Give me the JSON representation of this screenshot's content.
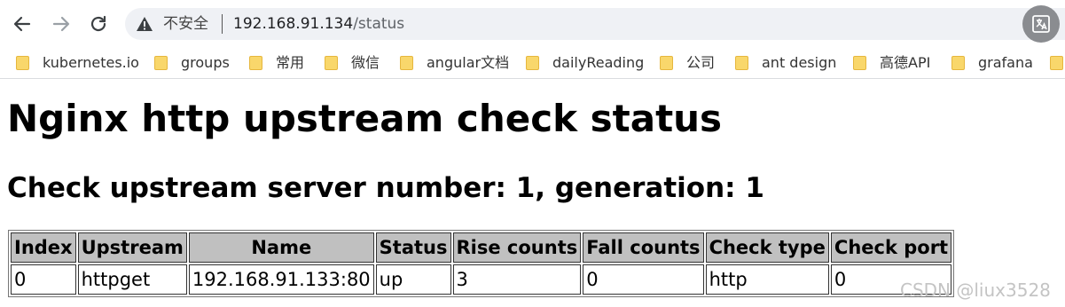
{
  "browser": {
    "back_icon": "arrow-left-icon",
    "forward_icon": "arrow-right-icon",
    "reload_icon": "reload-icon",
    "security_icon": "warning-triangle-icon",
    "security_label": "不安全",
    "url_host": "192.168.91.134",
    "url_path": "/status",
    "translate_icon": "translate-icon"
  },
  "bookmarks": [
    {
      "label": "kubernetes.io"
    },
    {
      "label": "groups"
    },
    {
      "label": "常用"
    },
    {
      "label": "微信"
    },
    {
      "label": "angular文档"
    },
    {
      "label": "dailyReading"
    },
    {
      "label": "公司"
    },
    {
      "label": "ant design"
    },
    {
      "label": "高德API"
    },
    {
      "label": "grafana"
    }
  ],
  "page": {
    "title": "Nginx http upstream check status",
    "subtitle": "Check upstream server number: 1, generation: 1",
    "table": {
      "headers": [
        "Index",
        "Upstream",
        "Name",
        "Status",
        "Rise counts",
        "Fall counts",
        "Check type",
        "Check port"
      ],
      "rows": [
        [
          "0",
          "httpget",
          "192.168.91.133:80",
          "up",
          "3",
          "0",
          "http",
          "0"
        ]
      ]
    }
  },
  "watermark": "CSDN @liux3528",
  "colors": {
    "header_bg": "#c0c0c0",
    "omnibox_bg": "#eff1f5",
    "folder": "#f9d76b"
  }
}
